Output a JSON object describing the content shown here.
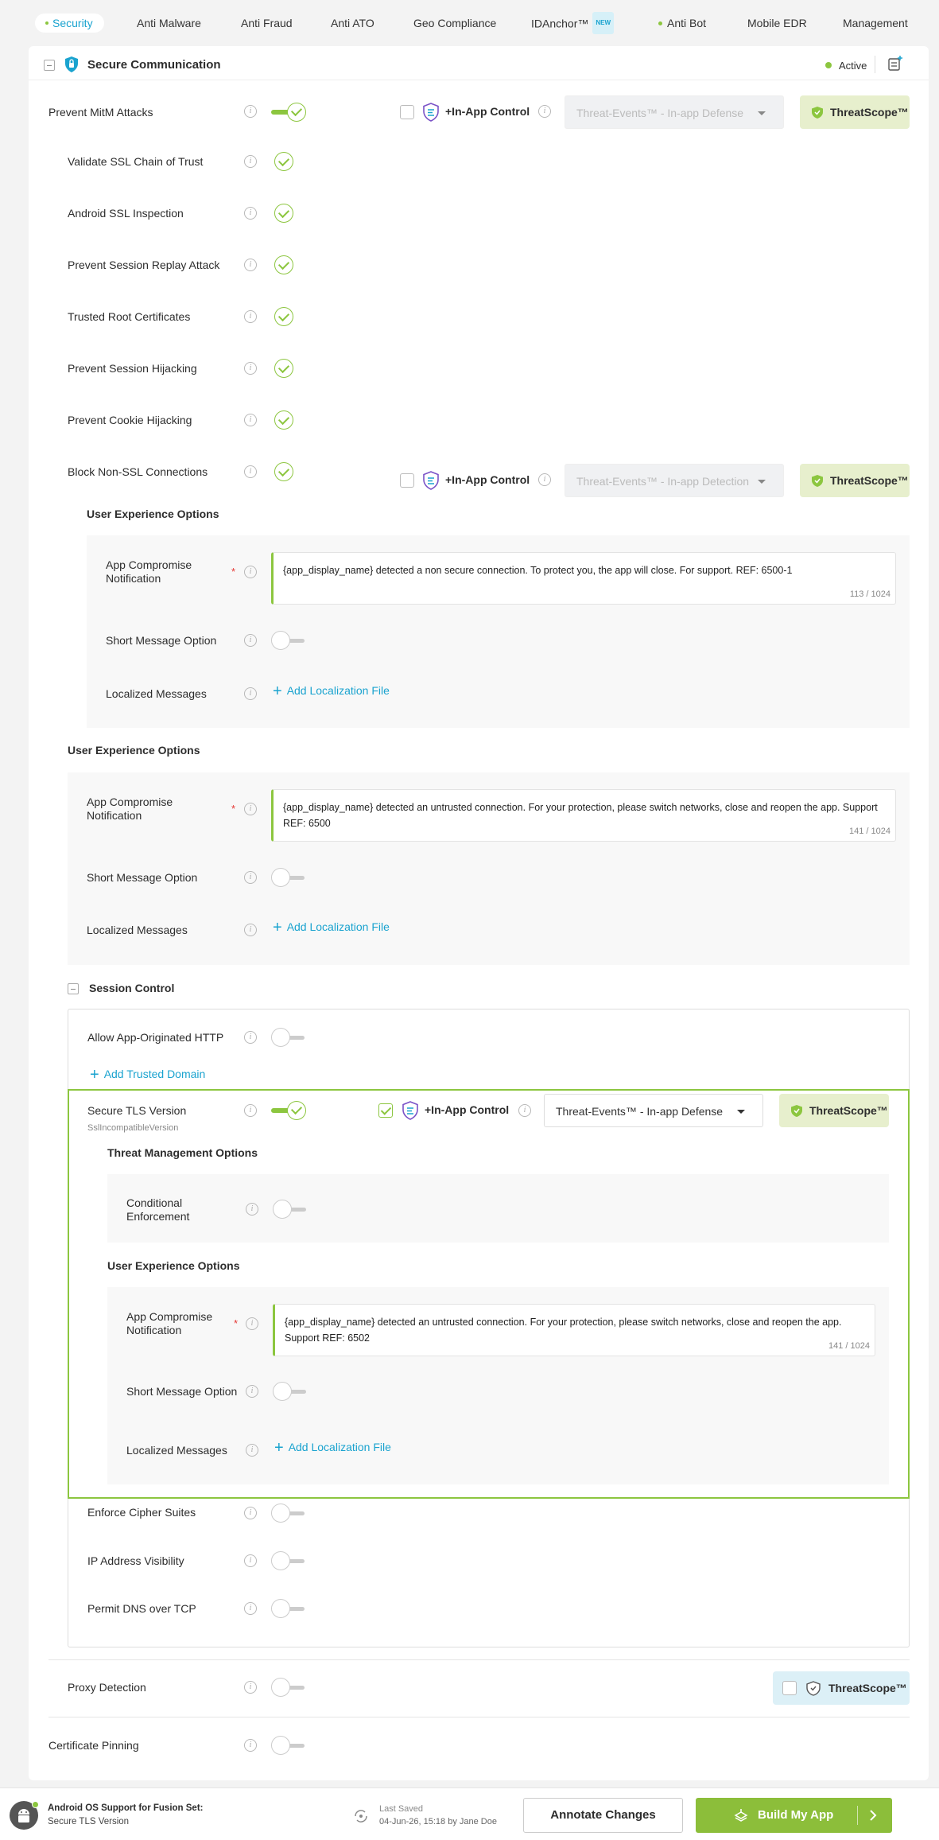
{
  "tabs": [
    {
      "label": "Security"
    },
    {
      "label": "Anti Malware"
    },
    {
      "label": "Anti Fraud"
    },
    {
      "label": "Anti ATO"
    },
    {
      "label": "Geo Compliance"
    },
    {
      "label": "IDAnchor™",
      "badge": "NEW"
    },
    {
      "label": "Anti Bot"
    },
    {
      "label": "Mobile EDR"
    },
    {
      "label": "Management"
    }
  ],
  "section": {
    "title": "Secure Communication",
    "status": "Active"
  },
  "inapp": {
    "label": "+In-App Control",
    "defense": "Threat-Events™ - In-app Defense",
    "detection": "Threat-Events™ - In-app Detection"
  },
  "threatscope": "ThreatScope™",
  "rows": {
    "mitm": "Prevent MitM Attacks",
    "ssl_chain": "Validate SSL Chain of Trust",
    "android_ssl": "Android SSL Inspection",
    "session_replay": "Prevent Session Replay Attack",
    "trusted_root": "Trusted Root Certificates",
    "session_hijack": "Prevent Session Hijacking",
    "cookie_hijack": "Prevent Cookie Hijacking",
    "non_ssl": "Block Non-SSL Connections",
    "allow_http": "Allow App-Originated HTTP",
    "secure_tls": "Secure TLS Version",
    "secure_tls_sub": "SslIncompatibleVersion",
    "cipher": "Enforce Cipher Suites",
    "ip_vis": "IP Address Visibility",
    "dns_tcp": "Permit DNS over TCP",
    "proxy": "Proxy Detection",
    "cert_pin": "Certificate Pinning"
  },
  "ux": {
    "header": "User Experience Options",
    "app_comp": "App Compromise Notification",
    "short_msg": "Short Message Option",
    "localized": "Localized Messages",
    "add_loc": "Add Localization File",
    "msg1": "{app_display_name} detected a non secure connection. To protect you, the app will close. For support. REF: 6500-1",
    "cnt1": "113 / 1024",
    "msg2": "{app_display_name} detected an untrusted connection. For your protection, please switch networks, close and reopen the app. Support REF: 6500",
    "cnt2": "141 / 1024",
    "msg3": "{app_display_name} detected an untrusted connection. For your protection, please switch networks, close and reopen the app. Support REF: 6502",
    "cnt3": "141 / 1024"
  },
  "session": {
    "title": "Session Control",
    "add_domain": "Add Trusted Domain"
  },
  "tm": {
    "header": "Threat Management Options",
    "cond": "Conditional Enforcement"
  },
  "footer": {
    "line1": "Android OS Support for Fusion Set:",
    "line2": "Secure TLS Version",
    "saved_label": "Last Saved",
    "saved_value": "04-Jun-26, 15:18 by Jane Doe",
    "annotate": "Annotate Changes",
    "build": "Build My App"
  },
  "colors": {
    "accent": "#8cc63f",
    "link": "#1aa3cf",
    "required": "#e53935"
  },
  "icons": [
    "shield-icon",
    "info-icon",
    "check-icon",
    "add-note-icon",
    "android-icon",
    "save-status-icon",
    "build-icon",
    "chevron-right-icon"
  ]
}
